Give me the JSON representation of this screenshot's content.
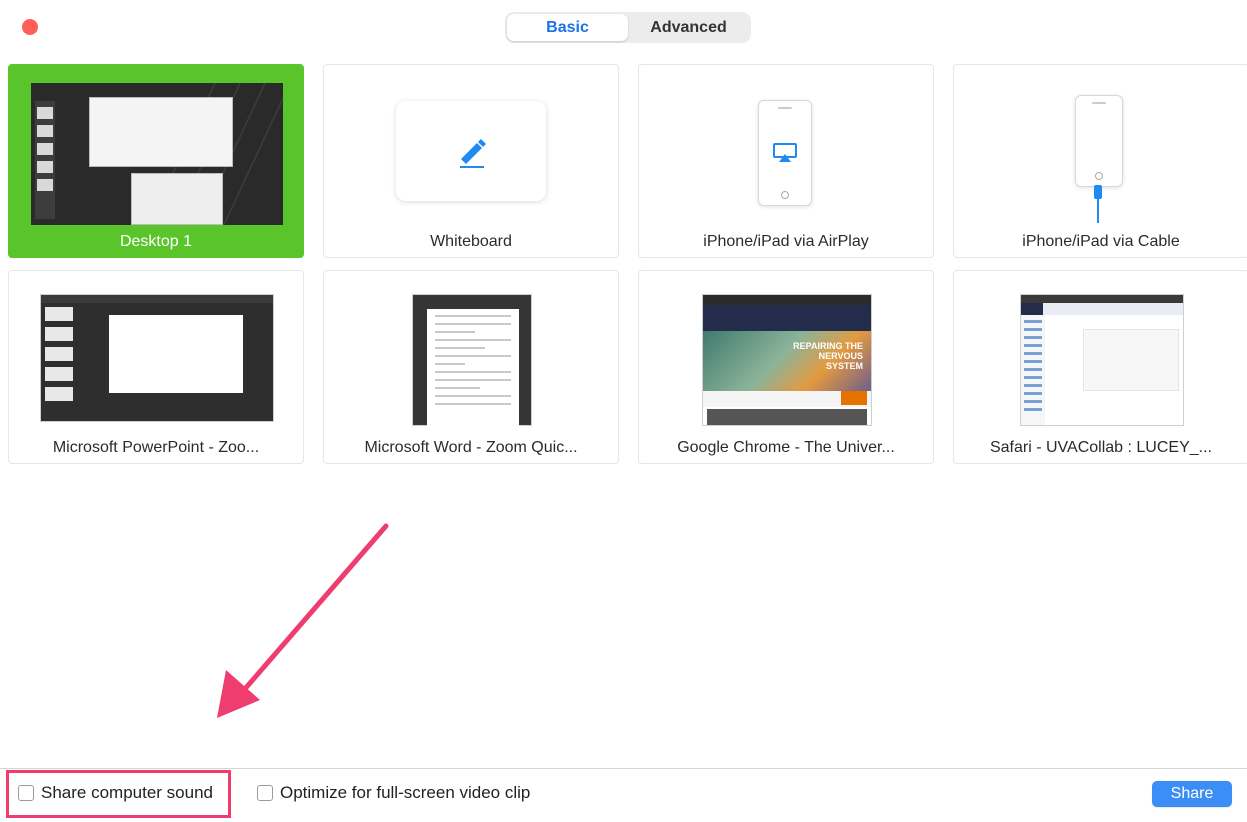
{
  "tabs": [
    {
      "label": "Basic",
      "active": true
    },
    {
      "label": "Advanced",
      "active": false
    }
  ],
  "tiles": [
    {
      "label": "Desktop 1",
      "selected": true
    },
    {
      "label": "Whiteboard"
    },
    {
      "label": "iPhone/iPad via AirPlay"
    },
    {
      "label": "iPhone/iPad via Cable"
    },
    {
      "label": "Microsoft PowerPoint - Zoo..."
    },
    {
      "label": "Microsoft Word - Zoom Quic..."
    },
    {
      "label": "Google Chrome - The Univer..."
    },
    {
      "label": "Safari - UVACollab : LUCEY_..."
    }
  ],
  "thumbnail_text": {
    "chrome_hero": "REPAIRING THE NERVOUS SYSTEM"
  },
  "options": {
    "share_sound": "Share computer sound",
    "optimize_video": "Optimize for full-screen video clip"
  },
  "actions": {
    "share": "Share"
  },
  "colors": {
    "selected_tile": "#5ac42b",
    "accent_blue": "#3a8ef6",
    "annotation_pink": "#ee3d6e",
    "close_red": "#fe5f57"
  }
}
